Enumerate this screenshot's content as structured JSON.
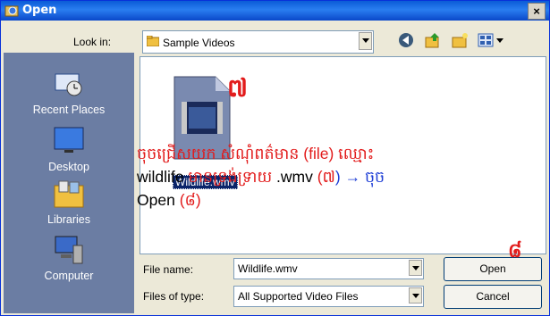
{
  "window": {
    "title": "Open",
    "close_label": "×"
  },
  "toolbar": {
    "look_in_label": "Look in:",
    "look_in_value": "Sample Videos",
    "icons": [
      "back-icon",
      "up-folder-icon",
      "new-folder-icon",
      "views-icon"
    ]
  },
  "places": [
    {
      "label": "Recent Places",
      "icon": "recent-places-icon"
    },
    {
      "label": "Desktop",
      "icon": "desktop-icon"
    },
    {
      "label": "Libraries",
      "icon": "libraries-icon"
    },
    {
      "label": "Computer",
      "icon": "computer-icon"
    }
  ],
  "files": [
    {
      "name": "Wildlife.wmv",
      "icon": "wmv-file-icon"
    }
  ],
  "annotation": {
    "step_7": "៧",
    "step_8": "៨",
    "line1": "ចុចជ្រើសយក សំណុំពត៌មាន (file) ឈ្មោះ",
    "line2_a": "wildlife",
    "line2_b": " មានទ្រង់ទ្រាយ ",
    "line2_c": ".wmv",
    "line2_d": " (",
    "line2_e": "៧",
    "line2_f": ") → ចុច",
    "line3_a": "Open ",
    "line3_b": "(",
    "line3_c": "៨",
    "line3_d": ")"
  },
  "form": {
    "file_name_label": "File name:",
    "file_name_value": "Wildlife.wmv",
    "files_of_type_label": "Files of type:",
    "files_of_type_value": "All Supported Video Files",
    "open_button": "Open",
    "cancel_button": "Cancel"
  },
  "colors": {
    "title_bar": "#0a5bd7",
    "places_bar": "#6b7da3",
    "annotation_red": "#e21c1c",
    "annotation_blue": "#1f3fd6"
  }
}
